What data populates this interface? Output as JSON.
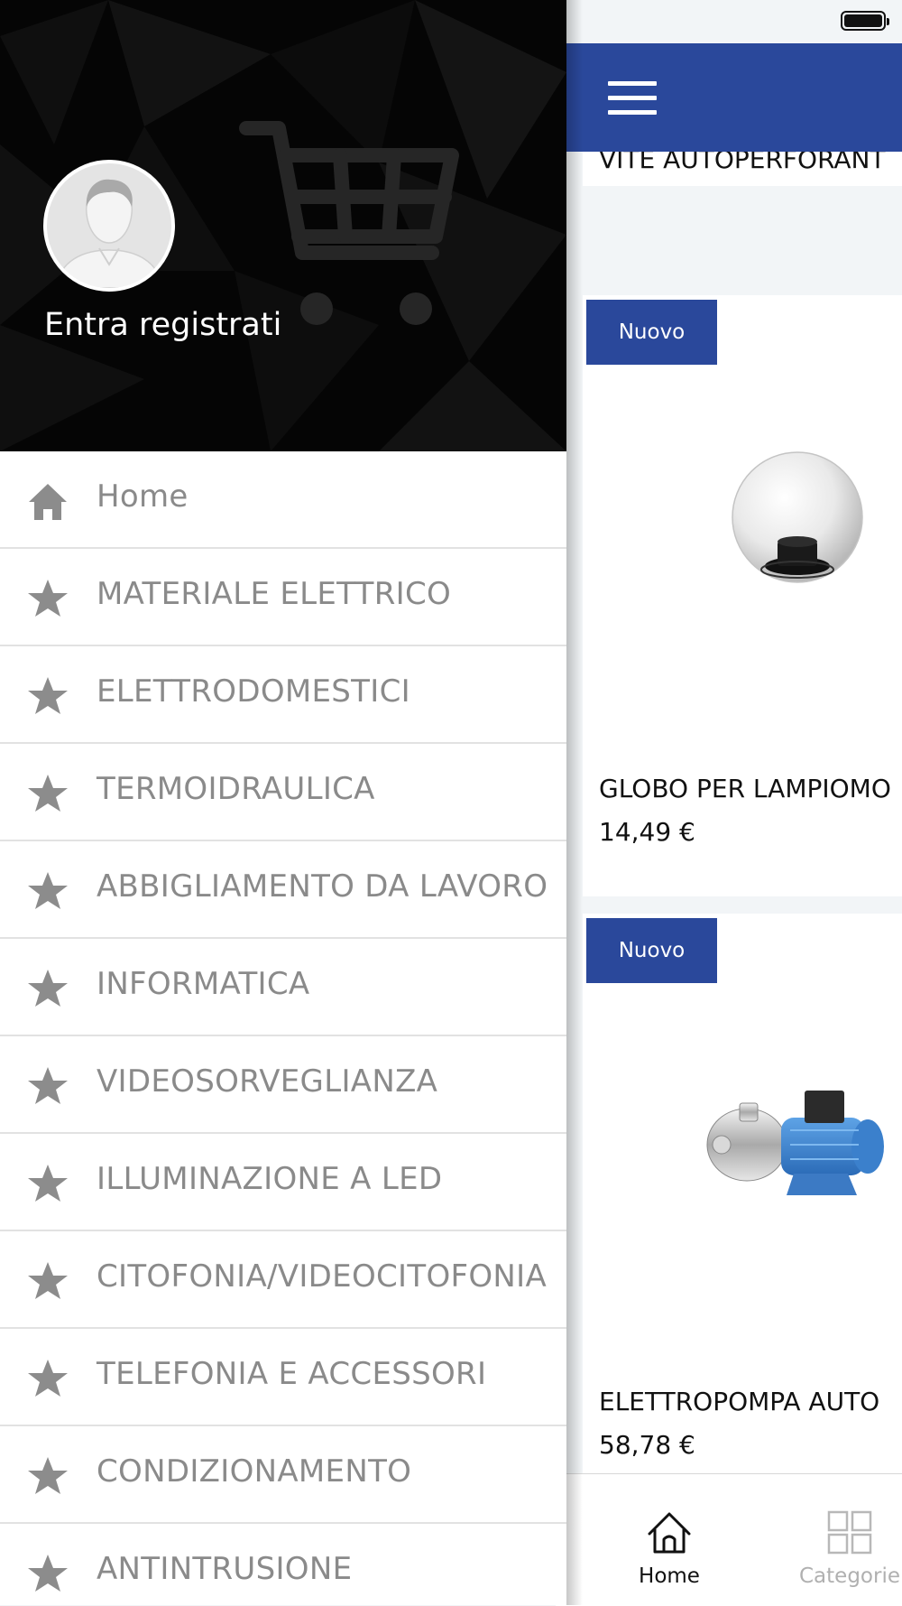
{
  "drawer": {
    "login_text": "Entra registrati",
    "menu_items": [
      {
        "label": "Home",
        "icon": "home-icon"
      },
      {
        "label": "MATERIALE ELETTRICO",
        "icon": "star-icon"
      },
      {
        "label": "ELETTRODOMESTICI",
        "icon": "star-icon"
      },
      {
        "label": "TERMOIDRAULICA",
        "icon": "star-icon"
      },
      {
        "label": "ABBIGLIAMENTO DA LAVORO",
        "icon": "star-icon"
      },
      {
        "label": "INFORMATICA",
        "icon": "star-icon"
      },
      {
        "label": "VIDEOSORVEGLIANZA",
        "icon": "star-icon"
      },
      {
        "label": "ILLUMINAZIONE A LED",
        "icon": "star-icon"
      },
      {
        "label": "CITOFONIA/VIDEOCITOFONIA",
        "icon": "star-icon"
      },
      {
        "label": "TELEFONIA E ACCESSORI",
        "icon": "star-icon"
      },
      {
        "label": "CONDIZIONAMENTO",
        "icon": "star-icon"
      },
      {
        "label": "ANTINTRUSIONE",
        "icon": "star-icon"
      }
    ]
  },
  "app": {
    "prev_product_name": "VITE AUTOPERFORANT",
    "products": [
      {
        "badge": "Nuovo",
        "name": "GLOBO PER LAMPIOMO",
        "price": "14,49 €",
        "image": "globe-lamp-image"
      },
      {
        "badge": "Nuovo",
        "name": "ELETTROPOMPA AUTO",
        "price": "58,78 €",
        "image": "electric-pump-image"
      }
    ],
    "tabbar": {
      "home_label": "Home",
      "categories_label": "Categorie"
    }
  },
  "colors": {
    "brand_blue": "#2a489b",
    "drawer_header_bg": "#050505",
    "menu_text": "#8a8a8a",
    "inactive_tab": "#b0b0b0"
  }
}
